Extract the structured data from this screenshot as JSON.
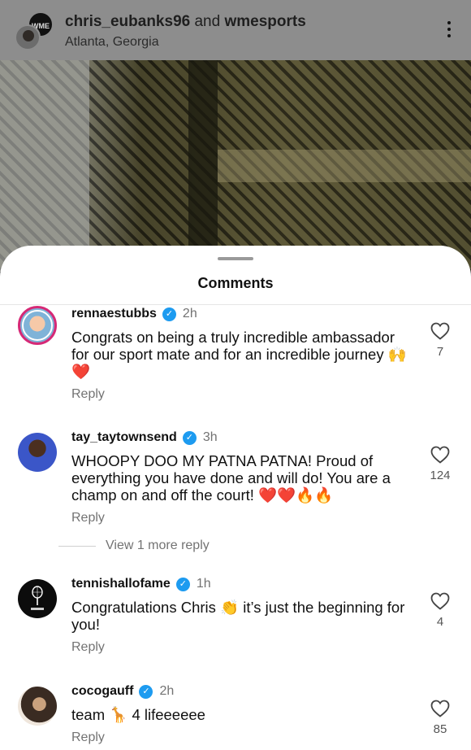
{
  "header": {
    "user1": "chris_eubanks96",
    "connector": " and ",
    "user2": "wmesports",
    "location": "Atlanta, Georgia",
    "avatar_back_text": "WME"
  },
  "sheet": {
    "title": "Comments"
  },
  "comments": [
    {
      "username": "rennaestubbs",
      "verified": true,
      "time": "2h",
      "text": "Congrats on being a truly incredible ambassador for our sport mate and for an incredible journey 🙌❤️",
      "reply_label": "Reply",
      "likes": "7",
      "avatar": "tennis-podcast-avatar"
    },
    {
      "username": "tay_taytownsend",
      "verified": true,
      "time": "3h",
      "text": "WHOOPY DOO MY PATNA PATNA! Proud of everything you have done and will do! You are a champ on and off the court! ❤️❤️🔥🔥",
      "reply_label": "Reply",
      "likes": "124",
      "avatar": "player-avatar"
    },
    {
      "username": "tennishallofame",
      "verified": true,
      "time": "1h",
      "text": "Congratulations Chris 👏 it’s just the beginning for you!",
      "reply_label": "Reply",
      "likes": "4",
      "avatar": "itmf-logo-avatar"
    },
    {
      "username": "cocogauff",
      "verified": true,
      "time": "2h",
      "text": "team 🦒 4 lifeeeeee",
      "reply_label": "Reply",
      "likes": "85",
      "avatar": "portrait-avatar"
    }
  ],
  "view_more_replies": "View 1 more reply",
  "icons": {
    "more": "more-vertical-icon",
    "like": "heart-outline-icon",
    "verified": "verified-badge-icon"
  },
  "colors": {
    "verified": "#1d9bf0",
    "secondary_text": "#737373"
  }
}
